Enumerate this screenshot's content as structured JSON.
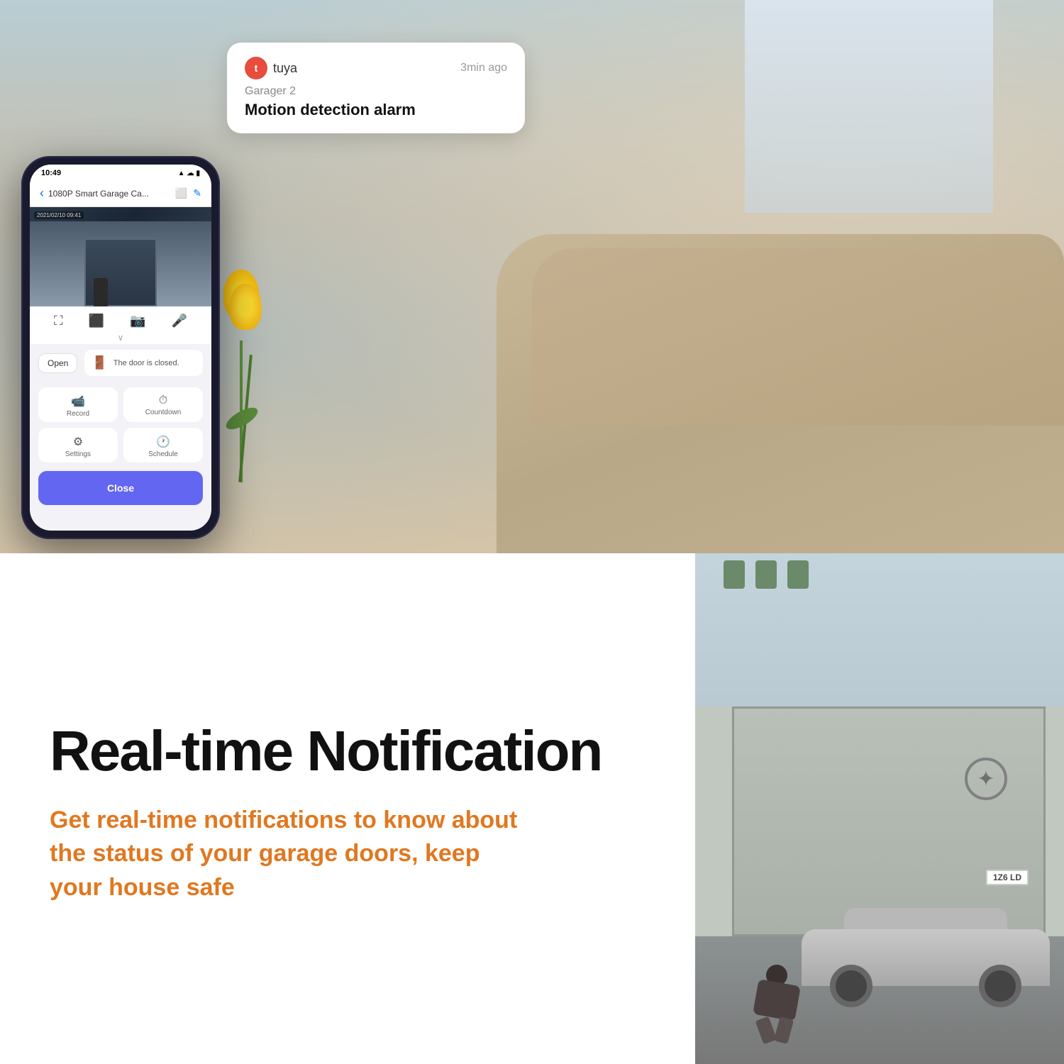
{
  "notification": {
    "app_name": "tuya",
    "time_ago": "3min ago",
    "device": "Garager 2",
    "message": "Motion detection alarm"
  },
  "phone": {
    "status_bar": {
      "time": "10:49",
      "signal": "●●●",
      "wifi": "▲",
      "battery": "▮"
    },
    "title": "1080P Smart Garage Ca...",
    "camera_timestamp": "2021/02/10 09:41",
    "door_status": "The door is closed.",
    "open_btn": "Open",
    "close_btn": "Close",
    "controls": {
      "fullscreen": "⛶",
      "record": "⬛",
      "snapshot": "📷",
      "mic": "🎤"
    },
    "actions": [
      {
        "icon": "📹",
        "label": "Record"
      },
      {
        "icon": "⏱",
        "label": "Countdown"
      },
      {
        "icon": "⚙",
        "label": "Settings"
      },
      {
        "icon": "🕐",
        "label": "Schedule"
      }
    ]
  },
  "bottom": {
    "title": "Real-time Notification",
    "subtitle": "Get real-time notifications to know about the status of your garage doors, keep your house safe"
  },
  "license_text": "1Z6 LD"
}
